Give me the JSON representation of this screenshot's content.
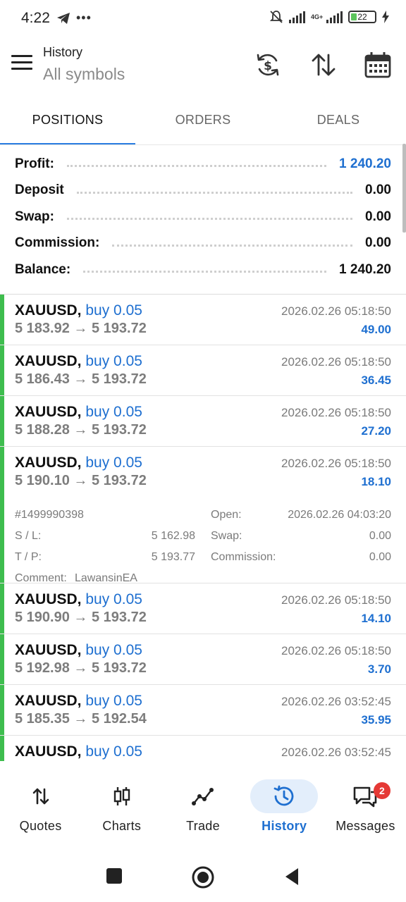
{
  "status_bar": {
    "time": "4:22",
    "network": "4G+",
    "battery": "22"
  },
  "app_bar": {
    "title": "History",
    "subtitle": "All symbols"
  },
  "tabs": [
    {
      "label": "POSITIONS",
      "active": true
    },
    {
      "label": "ORDERS",
      "active": false
    },
    {
      "label": "DEALS",
      "active": false
    }
  ],
  "summary": {
    "profit_label": "Profit:",
    "profit_value": "1 240.20",
    "deposit_label": "Deposit",
    "deposit_value": "0.00",
    "swap_label": "Swap:",
    "swap_value": "0.00",
    "commission_label": "Commission:",
    "commission_value": "0.00",
    "balance_label": "Balance:",
    "balance_value": "1 240.20"
  },
  "positions": [
    {
      "symbol": "XAUUSD,",
      "side": "buy 0.05",
      "prices": "5 183.92 → 5 193.72",
      "time": "2026.02.26 05:18:50",
      "profit": "49.00"
    },
    {
      "symbol": "XAUUSD,",
      "side": "buy 0.05",
      "prices": "5 186.43 → 5 193.72",
      "time": "2026.02.26 05:18:50",
      "profit": "36.45"
    },
    {
      "symbol": "XAUUSD,",
      "side": "buy 0.05",
      "prices": "5 188.28 → 5 193.72",
      "time": "2026.02.26 05:18:50",
      "profit": "27.20"
    },
    {
      "symbol": "XAUUSD,",
      "side": "buy 0.05",
      "prices": "5 190.10 → 5 193.72",
      "time": "2026.02.26 05:18:50",
      "profit": "18.10",
      "details": {
        "ticket": "#1499990398",
        "open_label": "Open:",
        "open_value": "2026.02.26 04:03:20",
        "sl_label": "S / L:",
        "sl_value": "5 162.98",
        "swap_label": "Swap:",
        "swap_value": "0.00",
        "tp_label": "T / P:",
        "tp_value": "5 193.77",
        "commission_label": "Commission:",
        "commission_value": "0.00",
        "comment_label": "Comment:",
        "comment_value": "LawansinEA"
      }
    },
    {
      "symbol": "XAUUSD,",
      "side": "buy 0.05",
      "prices": "5 190.90 → 5 193.72",
      "time": "2026.02.26 05:18:50",
      "profit": "14.10"
    },
    {
      "symbol": "XAUUSD,",
      "side": "buy 0.05",
      "prices": "5 192.98 → 5 193.72",
      "time": "2026.02.26 05:18:50",
      "profit": "3.70"
    },
    {
      "symbol": "XAUUSD,",
      "side": "buy 0.05",
      "prices": "5 185.35 → 5 192.54",
      "time": "2026.02.26 03:52:45",
      "profit": "35.95"
    },
    {
      "symbol": "XAUUSD,",
      "side": "buy 0.05",
      "prices": "",
      "time": "2026.02.26 03:52:45",
      "profit": ""
    }
  ],
  "bottom_nav": [
    {
      "label": "Quotes",
      "icon": "quotes-arrows-icon"
    },
    {
      "label": "Charts",
      "icon": "candlestick-icon"
    },
    {
      "label": "Trade",
      "icon": "trade-line-icon"
    },
    {
      "label": "History",
      "icon": "history-clock-icon",
      "active": true
    },
    {
      "label": "Messages",
      "icon": "chat-icon",
      "badge": "2"
    }
  ],
  "colors": {
    "accent": "#1e6fd0",
    "buy_bar": "#3ebd4e",
    "badge": "#e53935"
  }
}
